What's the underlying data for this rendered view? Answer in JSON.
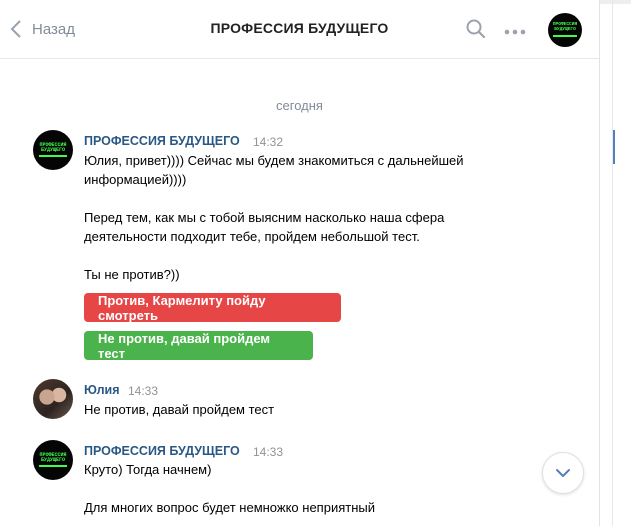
{
  "header": {
    "back_label": "Назад",
    "title": "ПРОФЕССИЯ БУДУЩЕГО",
    "avatar_text": "ПРОФЕССИЯ БУДУЩЕГО"
  },
  "date_separator": "сегодня",
  "messages": [
    {
      "author": "ПРОФЕССИЯ БУДУЩЕГО",
      "time": "14:32",
      "avatar_text": "ПРОФЕССИЯ БУДУЩЕГО",
      "lines": [
        "Юлия, привет)))) Сейчас мы будем знакомиться с дальнейшей",
        "информацией))))",
        "",
        "Перед тем, как мы с тобой выясним насколько наша сфера",
        "деятельности подходит тебе, пройдем небольшой тест.",
        "",
        "Ты не против?))"
      ],
      "buttons": [
        {
          "label": "Против, Кармелиту пойду смотреть",
          "color": "#e64646"
        },
        {
          "label": "Не против, давай пройдем тест",
          "color": "#4bb34b"
        }
      ]
    },
    {
      "author": "Юлия",
      "time": "14:33",
      "text": "Не против, давай пройдем тест"
    },
    {
      "author": "ПРОФЕССИЯ БУДУЩЕГО",
      "time": "14:33",
      "avatar_text": "ПРОФЕССИЯ БУДУЩЕГО",
      "text": "Круто) Тогда начнем)",
      "text2": "Для многих вопрос будет немножко неприятный"
    }
  ],
  "icons": {
    "back": "chevron-left-icon",
    "search": "search-icon",
    "more": "more-dots-icon",
    "scroll_down": "chevron-down-icon"
  },
  "colors": {
    "link": "#2a5885",
    "red_button": "#e64646",
    "green_button": "#4bb34b",
    "logo_green": "#39ff4a"
  }
}
